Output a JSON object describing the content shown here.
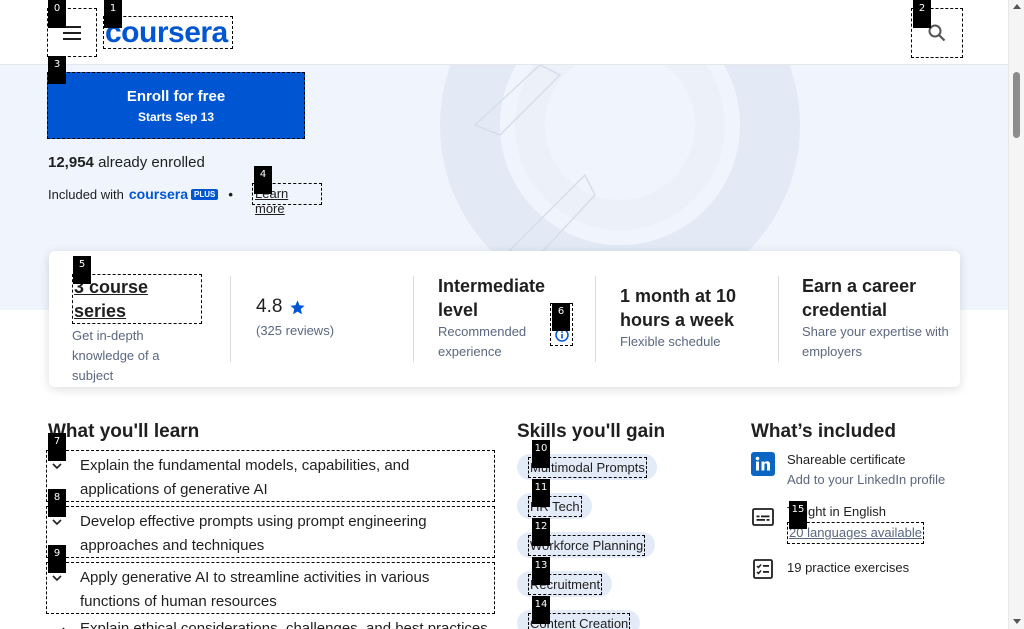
{
  "header": {
    "menu_icon": "hamburger-menu-icon",
    "logo_text": "coursera",
    "search_icon": "search-icon"
  },
  "hero": {
    "enroll_label": "Enroll for free",
    "enroll_sub": "Starts Sep 13",
    "enrolled_count": "12,954",
    "enrolled_suffix": "already enrolled",
    "included_prefix": "Included with",
    "plus_logo": "coursera",
    "plus_badge": "PLUS",
    "separator": "•",
    "learn_more": "Learn more"
  },
  "info": {
    "series_title": "3 course series",
    "series_sub": "Get in-depth knowledge of a subject",
    "rating": "4.8",
    "rating_icon": "star-icon",
    "reviews": "(325 reviews)",
    "level_title": "Intermediate level",
    "level_sub": "Recommended experience",
    "level_info_icon": "info-icon",
    "schedule_title": "1 month at 10 hours a week",
    "schedule_sub": "Flexible schedule",
    "credential_title": "Earn a career credential",
    "credential_sub": "Share your expertise with employers"
  },
  "learn": {
    "title": "What you'll learn",
    "items": [
      "Explain the fundamental models, capabilities, and applications of generative AI",
      "Develop effective prompts using prompt engineering approaches and techniques",
      "Apply generative AI to streamline activities in various functions of human resources",
      "Explain ethical considerations, challenges, and best practices"
    ]
  },
  "skills": {
    "title": "Skills you'll gain",
    "items": [
      "Multimodal Prompts",
      "HR Tech",
      "Workforce Planning",
      "Recruitment",
      "Content Creation"
    ]
  },
  "included": {
    "title": "What’s included",
    "certificate_title": "Shareable certificate",
    "certificate_sub": "Add to your LinkedIn profile",
    "language_title": "Taught in English",
    "language_link": "20 languages available",
    "exercises": "19 practice exercises"
  },
  "markers": [
    "0",
    "1",
    "2",
    "3",
    "4",
    "5",
    "6",
    "7",
    "8",
    "9",
    "10",
    "11",
    "12",
    "13",
    "14",
    "15"
  ],
  "colors": {
    "brand_blue": "#0056d2",
    "hero_bg": "#f0f5fd",
    "chip_bg": "#e3ebf8",
    "linkedin_blue": "#0a66c2"
  }
}
